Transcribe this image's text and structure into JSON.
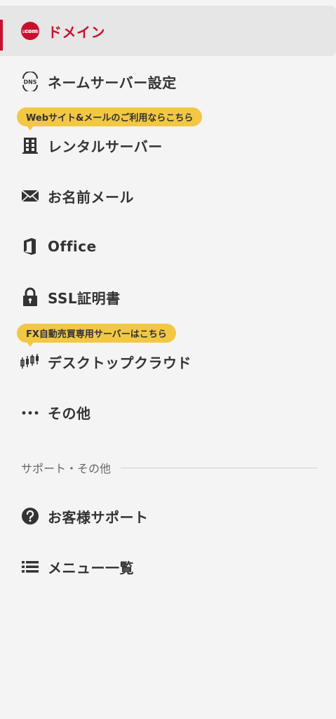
{
  "nav": {
    "items": [
      {
        "label": "ドメイン",
        "icon": "dot-com-icon"
      },
      {
        "label": "ネームサーバー設定",
        "icon": "dns-icon"
      },
      {
        "label": "レンタルサーバー",
        "icon": "server-icon"
      },
      {
        "label": "お名前メール",
        "icon": "mail-icon"
      },
      {
        "label": "Office",
        "icon": "office-icon"
      },
      {
        "label": "SSL証明書",
        "icon": "lock-icon"
      },
      {
        "label": "デスクトップクラウド",
        "icon": "chart-candles-icon"
      },
      {
        "label": "その他",
        "icon": "more-dots-icon"
      }
    ],
    "tags": {
      "rental_server": "Webサイト&メールのご利用ならこちら",
      "desktop_cloud": "FX自動売買専用サーバーはこちら"
    },
    "dot_com_badge": ".com",
    "dns_badge": "DNS"
  },
  "support": {
    "section_label": "サポート・その他",
    "items": [
      {
        "label": "お客様サポート",
        "icon": "help-icon"
      },
      {
        "label": "メニュー一覧",
        "icon": "list-icon"
      }
    ]
  },
  "colors": {
    "accent": "#c8102e",
    "tag_bg": "#f2c744",
    "background": "#f4f4f4",
    "active_bg": "#e6e6e6",
    "text": "#333333"
  }
}
